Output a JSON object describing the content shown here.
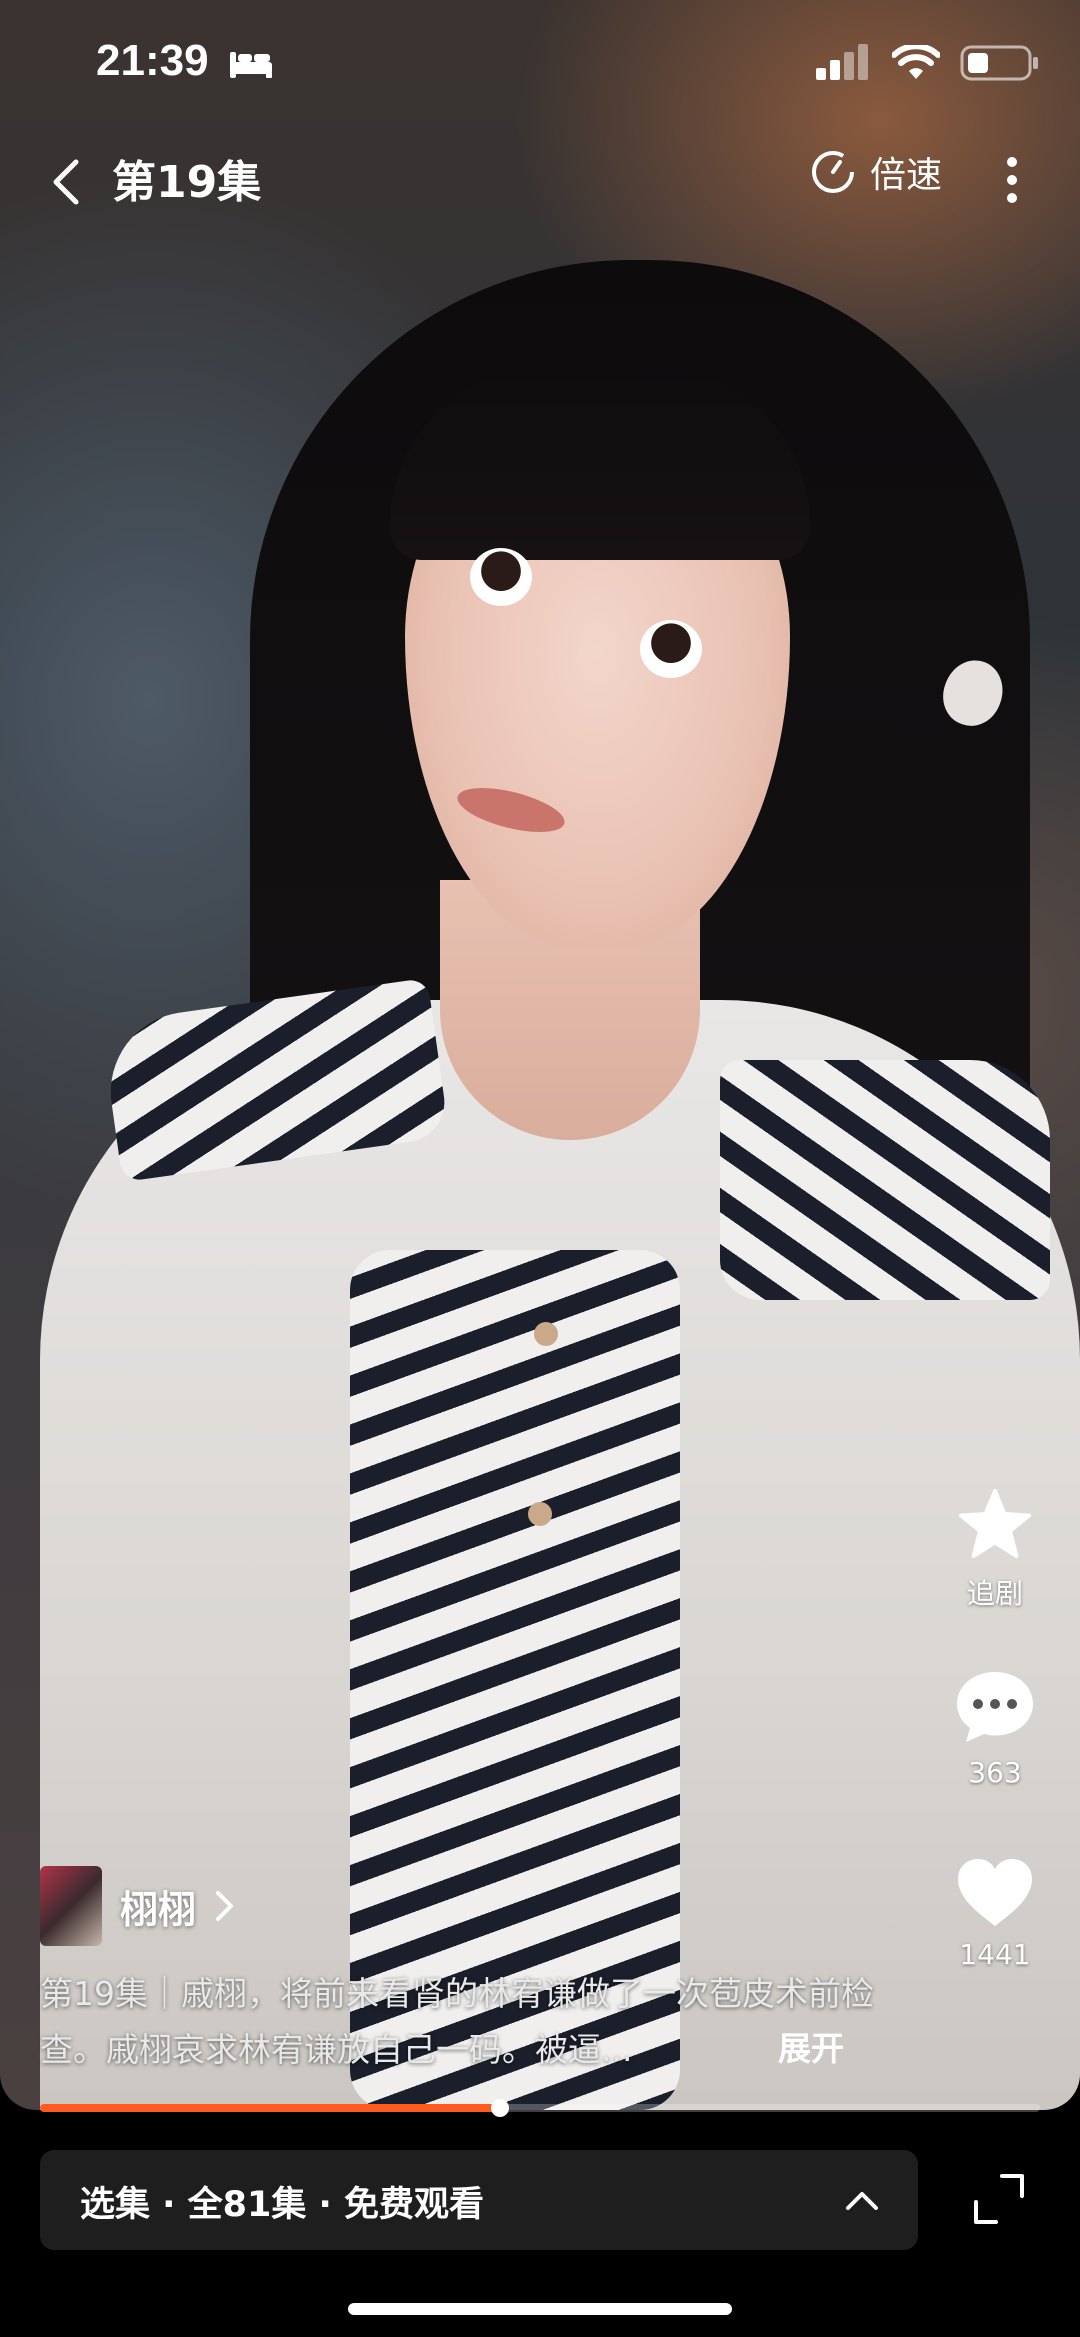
{
  "status_bar": {
    "time": "21:39",
    "icons": [
      "bed-icon",
      "cellular-icon",
      "wifi-icon",
      "battery-icon"
    ]
  },
  "topnav": {
    "title": "第19集",
    "speed_label": "倍速",
    "icons": [
      "back-icon",
      "speed-icon",
      "more-icon"
    ]
  },
  "actions": {
    "follow_label": "追剧",
    "comment_count": "363",
    "like_count": "1441"
  },
  "author": {
    "name": "栩栩"
  },
  "description": {
    "text": "第19集｜戚栩，将前来看肾的林宥谦做了一次苞皮术前检查。戚栩哀求林宥谦放自己一码。被逼...",
    "expand_label": "展开"
  },
  "progress": {
    "fraction": 0.46,
    "color": "#ff5a1f"
  },
  "episode_bar": {
    "label": "选集 · 全81集 · 免费观看"
  },
  "colors": {
    "accent": "#ff5a1f",
    "bar_bg": "#1e1e1e"
  }
}
